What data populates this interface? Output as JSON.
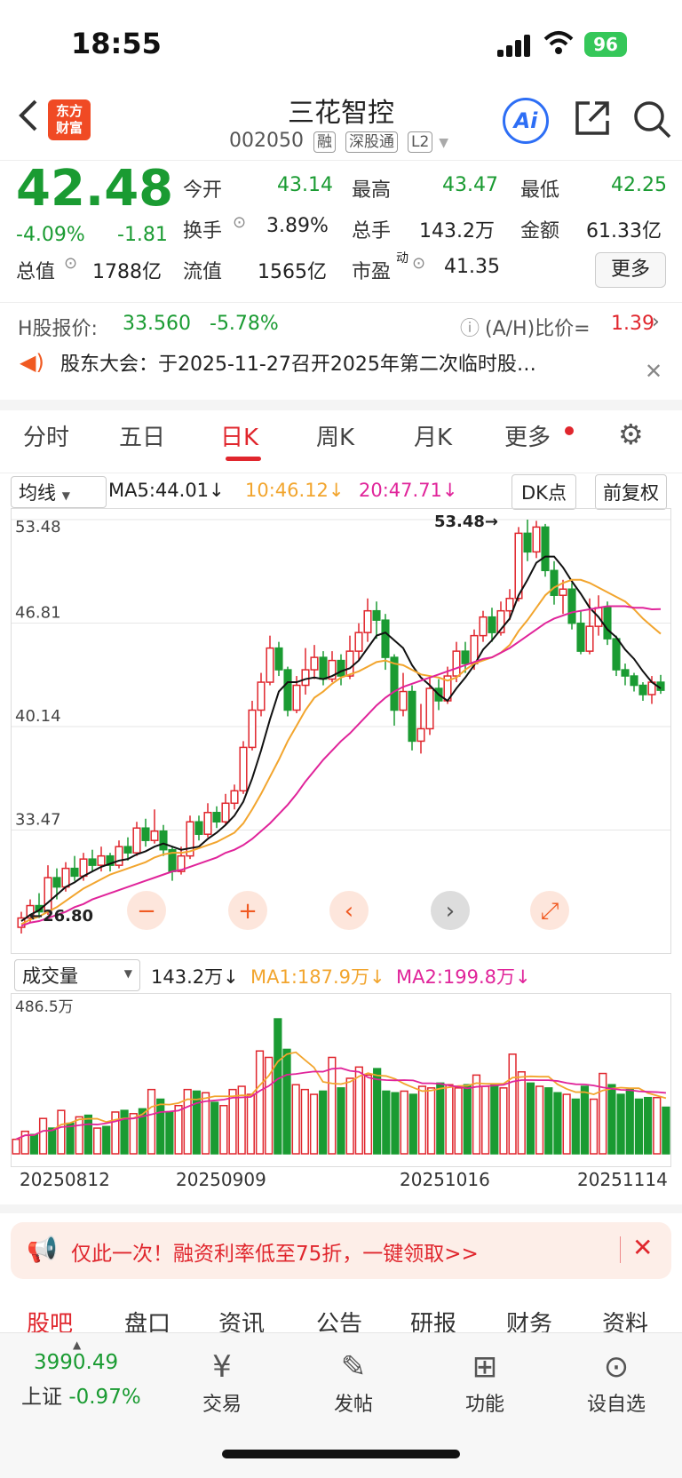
{
  "status": {
    "time": "18:55",
    "battery": "96"
  },
  "header": {
    "logo": "东方\n财富",
    "name": "三花智控",
    "code": "002050",
    "tags": [
      "融",
      "深股通",
      "L2"
    ],
    "ai": "Ai"
  },
  "quote": {
    "price": "42.48",
    "change_pct": "-4.09%",
    "change": "-1.81",
    "open_label": "今开",
    "open": "43.14",
    "high_label": "最高",
    "high": "43.47",
    "low_label": "最低",
    "low": "42.25",
    "turnover_label": "换手",
    "turnover": "3.89%",
    "vol_label": "总手",
    "vol": "143.2万",
    "amount_label": "金额",
    "amount": "61.33亿",
    "mcap_label": "总值",
    "mcap": "1788亿",
    "float_label": "流值",
    "float": "1565亿",
    "pe_label": "市盈",
    "pe_sup": "动",
    "pe": "41.35",
    "more": "更多"
  },
  "hshare": {
    "label": "H股报价:",
    "price": "33.560",
    "pct": "-5.78%",
    "ah_label": "(A/H)比价=",
    "ah": "1.39"
  },
  "notice": {
    "text": "股东大会：于2025-11-27召开2025年第二次临时股…"
  },
  "tabs": [
    "分时",
    "五日",
    "日K",
    "周K",
    "月K",
    "更多"
  ],
  "active_tab": "日K",
  "ma": {
    "select": "均线",
    "ma5": "MA5:44.01↓",
    "ma10": "10:46.12↓",
    "ma20": "20:47.71↓",
    "dk": "DK点",
    "fq": "前复权"
  },
  "chart_data": {
    "type": "candlestick",
    "y_ticks": [
      "53.48",
      "46.81",
      "40.14",
      "33.47"
    ],
    "ylim": [
      26.8,
      53.48
    ],
    "high_marker": "53.48→",
    "low_marker": "←26.80",
    "candles": [
      [
        27.2,
        27.8,
        26.8,
        28.2
      ],
      [
        27.8,
        28.6,
        27.5,
        29.0
      ],
      [
        28.6,
        28.2,
        27.8,
        29.4
      ],
      [
        28.2,
        30.4,
        28.0,
        31.2
      ],
      [
        30.4,
        29.8,
        29.0,
        31.0
      ],
      [
        29.8,
        31.0,
        29.5,
        31.4
      ],
      [
        31.0,
        30.5,
        30.2,
        31.8
      ],
      [
        30.5,
        31.6,
        30.2,
        32.0
      ],
      [
        31.6,
        31.2,
        30.8,
        32.2
      ],
      [
        31.2,
        31.8,
        30.8,
        32.4
      ],
      [
        31.8,
        31.2,
        30.8,
        32.0
      ],
      [
        31.2,
        32.4,
        31.0,
        32.8
      ],
      [
        32.4,
        32.0,
        31.5,
        33.0
      ],
      [
        32.0,
        33.6,
        31.8,
        34.0
      ],
      [
        33.6,
        32.8,
        32.4,
        34.2
      ],
      [
        32.8,
        33.4,
        32.6,
        34.8
      ],
      [
        33.4,
        32.2,
        31.8,
        33.8
      ],
      [
        32.2,
        30.8,
        30.2,
        32.4
      ],
      [
        30.8,
        31.8,
        30.6,
        32.4
      ],
      [
        31.8,
        34.0,
        31.6,
        34.4
      ],
      [
        34.0,
        33.2,
        32.8,
        34.4
      ],
      [
        33.2,
        34.6,
        33.0,
        35.2
      ],
      [
        34.6,
        34.0,
        33.6,
        35.0
      ],
      [
        34.0,
        35.2,
        33.8,
        35.8
      ],
      [
        35.2,
        36.0,
        34.8,
        36.4
      ],
      [
        36.0,
        38.8,
        35.8,
        39.2
      ],
      [
        38.8,
        41.2,
        38.6,
        41.8
      ],
      [
        41.2,
        43.0,
        40.8,
        43.6
      ],
      [
        43.0,
        45.2,
        42.8,
        46.0
      ],
      [
        45.2,
        43.8,
        43.4,
        45.6
      ],
      [
        43.8,
        41.2,
        40.8,
        44.0
      ],
      [
        41.2,
        42.8,
        41.0,
        43.4
      ],
      [
        42.8,
        43.8,
        42.2,
        45.2
      ],
      [
        43.8,
        44.6,
        43.2,
        45.4
      ],
      [
        44.6,
        43.2,
        42.8,
        45.0
      ],
      [
        43.2,
        44.4,
        43.0,
        45.0
      ],
      [
        44.4,
        43.4,
        42.8,
        44.8
      ],
      [
        43.4,
        45.0,
        43.2,
        46.0
      ],
      [
        45.0,
        46.2,
        44.4,
        46.8
      ],
      [
        46.2,
        47.6,
        45.6,
        48.4
      ],
      [
        47.6,
        47.0,
        45.8,
        48.2
      ],
      [
        47.0,
        44.6,
        43.8,
        47.4
      ],
      [
        44.6,
        41.2,
        40.2,
        44.8
      ],
      [
        41.2,
        42.4,
        40.8,
        43.6
      ],
      [
        42.4,
        39.2,
        38.6,
        42.8
      ],
      [
        39.2,
        40.0,
        38.4,
        41.6
      ],
      [
        40.0,
        42.6,
        39.6,
        43.4
      ],
      [
        42.6,
        41.8,
        41.2,
        43.2
      ],
      [
        41.8,
        43.4,
        41.6,
        44.0
      ],
      [
        43.4,
        45.0,
        43.0,
        45.6
      ],
      [
        45.0,
        44.2,
        43.6,
        45.6
      ],
      [
        44.2,
        46.0,
        43.8,
        46.4
      ],
      [
        46.0,
        47.2,
        45.6,
        47.6
      ],
      [
        47.2,
        46.2,
        45.6,
        47.8
      ],
      [
        46.2,
        47.6,
        46.0,
        48.2
      ],
      [
        47.6,
        48.4,
        47.0,
        49.0
      ],
      [
        48.4,
        52.6,
        48.2,
        53.0
      ],
      [
        52.6,
        51.4,
        50.8,
        53.48
      ],
      [
        51.4,
        53.0,
        51.0,
        53.4
      ],
      [
        53.0,
        50.2,
        49.8,
        53.2
      ],
      [
        50.2,
        48.6,
        48.0,
        50.8
      ],
      [
        48.6,
        49.0,
        47.4,
        49.6
      ],
      [
        49.0,
        46.8,
        46.4,
        49.4
      ],
      [
        46.8,
        45.0,
        44.8,
        47.6
      ],
      [
        45.0,
        46.6,
        44.8,
        48.4
      ],
      [
        46.6,
        47.8,
        46.0,
        48.6
      ],
      [
        47.8,
        45.8,
        45.4,
        48.2
      ],
      [
        45.8,
        43.8,
        43.4,
        46.0
      ],
      [
        43.8,
        43.4,
        42.8,
        44.2
      ],
      [
        43.4,
        42.8,
        42.4,
        43.6
      ],
      [
        42.8,
        42.2,
        41.8,
        43.0
      ],
      [
        42.2,
        43.0,
        41.6,
        43.4
      ],
      [
        43.0,
        42.48,
        42.25,
        43.47
      ]
    ],
    "ma5": [
      27.6,
      28.0,
      28.3,
      28.8,
      29.3,
      29.8,
      30.1,
      30.5,
      30.8,
      31.1,
      31.3,
      31.5,
      31.6,
      31.9,
      32.1,
      32.4,
      32.6,
      32.4,
      32.2,
      32.3,
      32.4,
      32.9,
      33.3,
      33.8,
      34.4,
      35.3,
      36.8,
      38.6,
      40.6,
      42.4,
      43.0,
      43.0,
      43.2,
      43.3,
      43.2,
      43.4,
      43.7,
      43.9,
      44.4,
      45.2,
      46.0,
      46.2,
      45.7,
      45.2,
      44.1,
      43.3,
      42.8,
      42.2,
      41.8,
      42.6,
      43.3,
      44.1,
      45.1,
      45.7,
      46.4,
      47.1,
      48.6,
      49.6,
      50.7,
      51.1,
      51.1,
      50.4,
      49.5,
      48.7,
      47.8,
      47.2,
      46.4,
      45.9,
      45.1,
      44.5,
      43.7,
      43.0,
      42.6
    ],
    "ma10": [
      27.4,
      27.7,
      27.9,
      28.2,
      28.5,
      28.9,
      29.3,
      29.7,
      30.0,
      30.3,
      30.6,
      30.8,
      31.0,
      31.2,
      31.4,
      31.7,
      31.9,
      32.0,
      32.0,
      32.1,
      32.3,
      32.5,
      32.7,
      33.0,
      33.3,
      33.9,
      34.8,
      35.8,
      36.9,
      38.0,
      39.2,
      40.2,
      41.2,
      42.0,
      42.4,
      42.9,
      43.3,
      43.5,
      43.7,
      44.0,
      44.3,
      44.4,
      44.2,
      44.1,
      43.8,
      43.5,
      43.4,
      43.3,
      43.1,
      43.3,
      43.8,
      44.2,
      44.4,
      44.6,
      44.9,
      45.4,
      46.3,
      47.0,
      47.8,
      48.6,
      49.1,
      49.4,
      49.6,
      49.6,
      49.4,
      49.1,
      48.8,
      48.5,
      48.2,
      47.7,
      47.1,
      46.6,
      46.12
    ],
    "ma20": [
      27.3,
      27.5,
      27.6,
      27.8,
      28.0,
      28.2,
      28.5,
      28.7,
      29.0,
      29.2,
      29.4,
      29.6,
      29.8,
      30.0,
      30.2,
      30.4,
      30.6,
      30.8,
      30.9,
      31.1,
      31.3,
      31.5,
      31.7,
      32.0,
      32.2,
      32.5,
      32.9,
      33.4,
      33.9,
      34.5,
      35.1,
      35.8,
      36.6,
      37.3,
      38.0,
      38.6,
      39.2,
      39.7,
      40.3,
      40.9,
      41.5,
      42.0,
      42.4,
      42.7,
      42.9,
      43.1,
      43.3,
      43.5,
      43.7,
      43.9,
      44.1,
      44.3,
      44.5,
      44.6,
      44.9,
      45.2,
      45.6,
      46.0,
      46.4,
      46.8,
      47.1,
      47.3,
      47.5,
      47.6,
      47.7,
      47.8,
      47.9,
      47.9,
      47.9,
      47.8,
      47.8,
      47.7,
      47.71
    ]
  },
  "chart_controls": [
    "−",
    "+",
    "‹",
    "›",
    "⤢"
  ],
  "volume": {
    "select": "成交量",
    "value": "143.2万↓",
    "ma1": "MA1:187.9万↓",
    "ma2": "MA2:199.8万↓",
    "top": "486.5万",
    "dates": [
      "20250812",
      "20250909",
      "20251016",
      "20251114"
    ],
    "bars": [
      45,
      70,
      60,
      110,
      80,
      135,
      95,
      115,
      120,
      80,
      85,
      130,
      135,
      125,
      140,
      200,
      170,
      130,
      150,
      200,
      195,
      190,
      160,
      150,
      200,
      210,
      185,
      320,
      300,
      420,
      325,
      215,
      200,
      185,
      195,
      300,
      205,
      235,
      270,
      245,
      265,
      195,
      190,
      195,
      185,
      210,
      205,
      220,
      215,
      205,
      215,
      245,
      210,
      215,
      205,
      310,
      255,
      220,
      210,
      205,
      190,
      185,
      170,
      210,
      170,
      250,
      215,
      185,
      200,
      170,
      175,
      175,
      145
    ]
  },
  "promo": {
    "text": "仅此一次！融资利率低至75折，一键领取>>"
  },
  "bottom_tabs": [
    "股吧",
    "盘口",
    "资讯",
    "公告",
    "研报",
    "财务",
    "资料"
  ],
  "dock": {
    "index": "3990.49",
    "index_name": "上证",
    "index_pct": "-0.97%",
    "items": [
      "交易",
      "发帖",
      "功能",
      "设自选"
    ]
  }
}
